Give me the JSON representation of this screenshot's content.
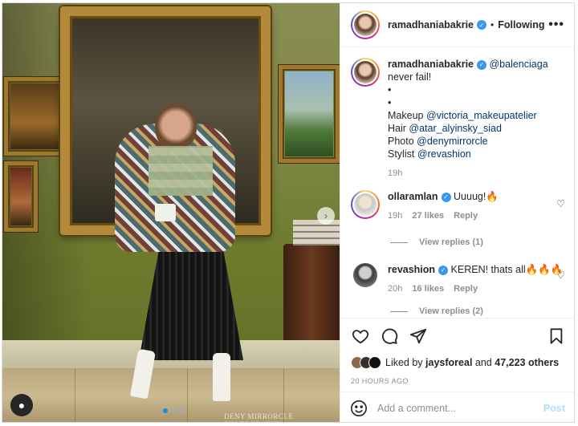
{
  "post": {
    "username": "ramadhaniabakrie",
    "follow_label": "Following",
    "more_label": "•••",
    "watermark": "DENY MIRRORCLE PHOTOGRAPHY"
  },
  "caption": {
    "username": "ramadhaniabakrie",
    "mention": "@balenciaga",
    "line1": "never fail!",
    "bullet1": "•",
    "bullet2": "•",
    "credits": [
      {
        "label": "Makeup",
        "handle": "@victoria_makeupatelier"
      },
      {
        "label": "Hair",
        "handle": "@atar_alyinsky_siad"
      },
      {
        "label": "Photo",
        "handle": "@denymirrorcle"
      },
      {
        "label": "Stylist",
        "handle": "@revashion"
      }
    ],
    "time": "19h"
  },
  "comments": [
    {
      "username": "ollaramlan",
      "text": "Uuuug!🔥",
      "time": "19h",
      "likes": "27 likes",
      "reply": "Reply",
      "view_replies": "View replies (1)"
    },
    {
      "username": "revashion",
      "text": "KEREN! thats all🔥🔥🔥",
      "time": "20h",
      "likes": "16 likes",
      "reply": "Reply",
      "view_replies": "View replies (2)"
    }
  ],
  "likes": {
    "prefix": "Liked by",
    "user": "jaysforeal",
    "joiner": "and",
    "others": "47,223 others"
  },
  "timestamp": "20 HOURS AGO",
  "add_comment": {
    "placeholder": "Add a comment...",
    "post_label": "Post"
  },
  "carousel": {
    "total": 3,
    "active": 1
  },
  "colors": {
    "link": "#00376b",
    "verified": "#3897f0",
    "post_disabled": "#b2dffc",
    "active_dot": "#0095f6"
  }
}
